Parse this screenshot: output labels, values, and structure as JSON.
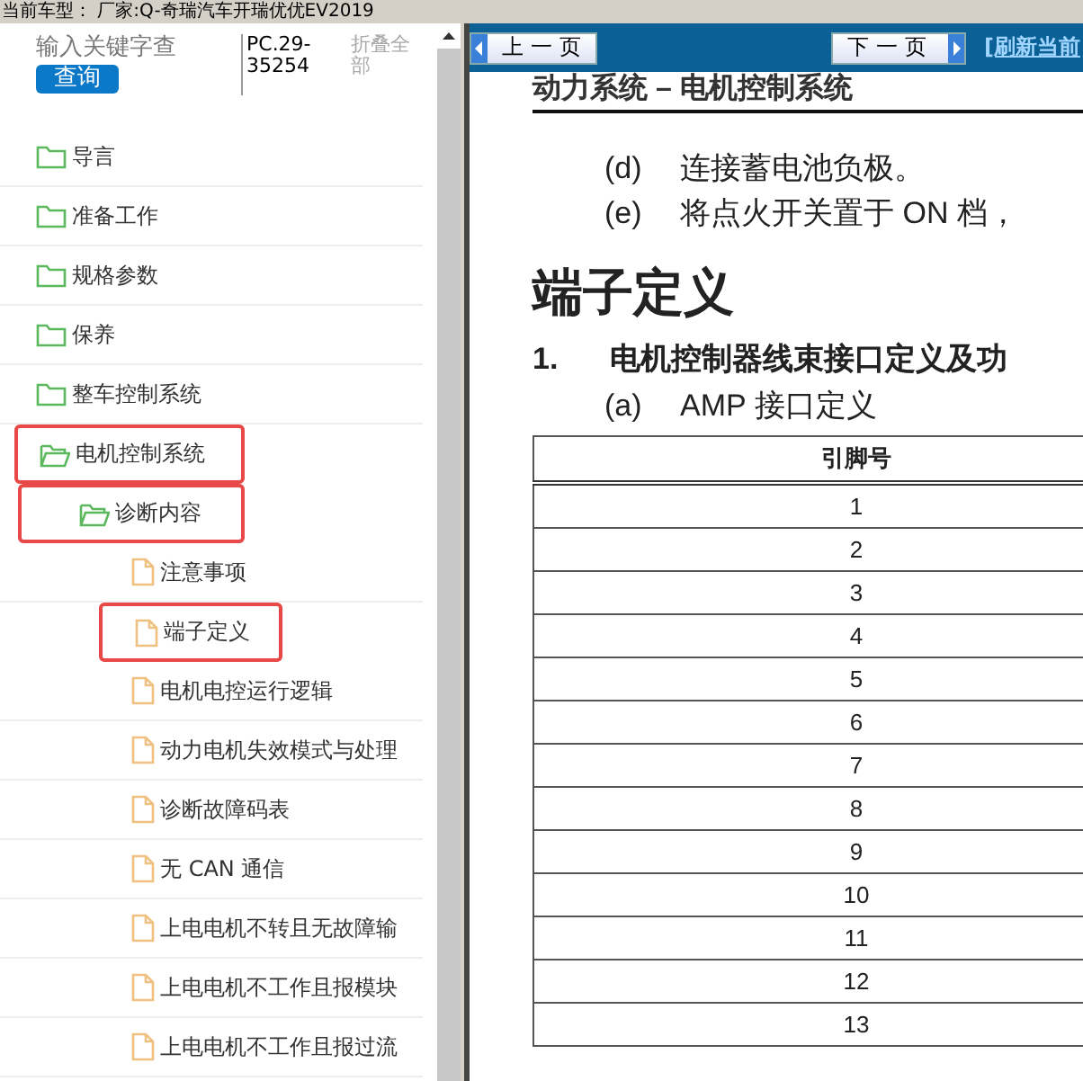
{
  "header": {
    "vehicle": "当前车型： 厂家:Q-奇瑞汽车开瑞优优EV2019"
  },
  "sidebar": {
    "search": {
      "placeholder": "输入关键字查"
    },
    "search_button": "查询",
    "code": "PC.29-35254",
    "collapse_link": "折叠全部",
    "tree": [
      {
        "label": "导言",
        "kind": "folder",
        "expanded": false,
        "highlighted": false
      },
      {
        "label": "准备工作",
        "kind": "folder",
        "expanded": false,
        "highlighted": false
      },
      {
        "label": "规格参数",
        "kind": "folder",
        "expanded": false,
        "highlighted": false
      },
      {
        "label": "保养",
        "kind": "folder",
        "expanded": false,
        "highlighted": false
      },
      {
        "label": "整车控制系统",
        "kind": "folder",
        "expanded": false,
        "highlighted": false
      },
      {
        "label": "电机控制系统",
        "kind": "folder",
        "expanded": true,
        "highlighted": true,
        "children": [
          {
            "label": "诊断内容",
            "kind": "folder",
            "expanded": true,
            "highlighted": true,
            "children": [
              {
                "label": "注意事项",
                "kind": "document",
                "highlighted": false
              },
              {
                "label": "端子定义",
                "kind": "document",
                "highlighted": true
              },
              {
                "label": "电机电控运行逻辑",
                "kind": "document",
                "highlighted": false
              },
              {
                "label": "动力电机失效模式与处理",
                "kind": "document",
                "highlighted": false
              },
              {
                "label": "诊断故障码表",
                "kind": "document",
                "highlighted": false
              },
              {
                "label": "无 CAN 通信",
                "kind": "document",
                "highlighted": false
              },
              {
                "label": "上电电机不转且无故障输",
                "kind": "document",
                "highlighted": false
              },
              {
                "label": "上电电机不工作且报模块",
                "kind": "document",
                "highlighted": false
              },
              {
                "label": "上电电机不工作且报过流",
                "kind": "document",
                "highlighted": false
              }
            ]
          }
        ]
      }
    ]
  },
  "viewer": {
    "prev_button": "上一页",
    "next_button": "下一页",
    "refresh_link": "[刷新当前",
    "document": {
      "running_head": "动力系统 – 电机控制系统",
      "steps": [
        {
          "marker": "(d)",
          "text": "连接蓄电池负极。"
        },
        {
          "marker": "(e)",
          "text": "将点火开关置于 ON 档，"
        }
      ],
      "heading": "端子定义",
      "section": {
        "number": "1.",
        "title": "电机控制器线束接口定义及功"
      },
      "subsection": {
        "marker": "(a)",
        "text": "AMP 接口定义"
      },
      "table": {
        "columns": [
          "引脚号"
        ],
        "rows": [
          [
            "1"
          ],
          [
            "2"
          ],
          [
            "3"
          ],
          [
            "4"
          ],
          [
            "5"
          ],
          [
            "6"
          ],
          [
            "7"
          ],
          [
            "8"
          ],
          [
            "9"
          ],
          [
            "10"
          ],
          [
            "11"
          ],
          [
            "12"
          ],
          [
            "13"
          ]
        ]
      }
    }
  }
}
